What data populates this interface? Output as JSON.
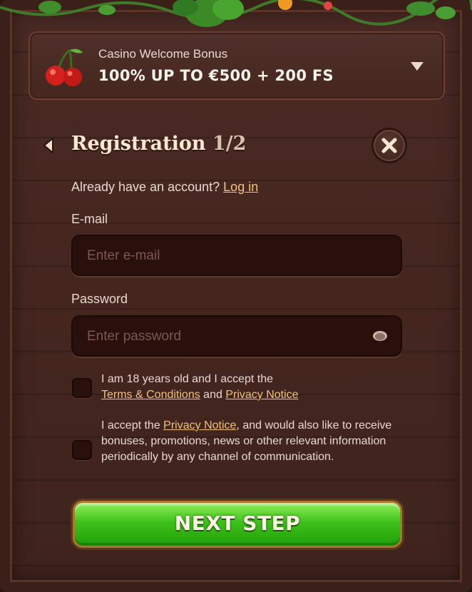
{
  "bonus": {
    "subtitle": "Casino Welcome Bonus",
    "title": "100% UP TO €500 + 200 FS",
    "icon": "cherry-icon"
  },
  "registration": {
    "title": "Registration",
    "step": "1/2",
    "login_prompt": "Already have an account?",
    "login_link": "Log in"
  },
  "form": {
    "email_label": "E-mail",
    "email_placeholder": "Enter e-mail",
    "email_value": "",
    "password_label": "Password",
    "password_placeholder": "Enter password",
    "password_value": ""
  },
  "consents": {
    "age": {
      "text_before": "I am 18 years old and I accept the",
      "terms_link": "Terms & Conditions",
      "and": "and",
      "privacy_link": "Privacy Notice",
      "checked": false
    },
    "marketing": {
      "text_before": "I accept the",
      "privacy_link": "Privacy Notice",
      "text_after": ", and would also like to receive bonuses, promotions, news or other relevant information periodically by any channel of communication.",
      "checked": false
    }
  },
  "actions": {
    "next_label": "NEXT STEP"
  },
  "colors": {
    "background": "#44261f",
    "accent_link": "#f2c27b",
    "button_green": "#3fc11a"
  }
}
